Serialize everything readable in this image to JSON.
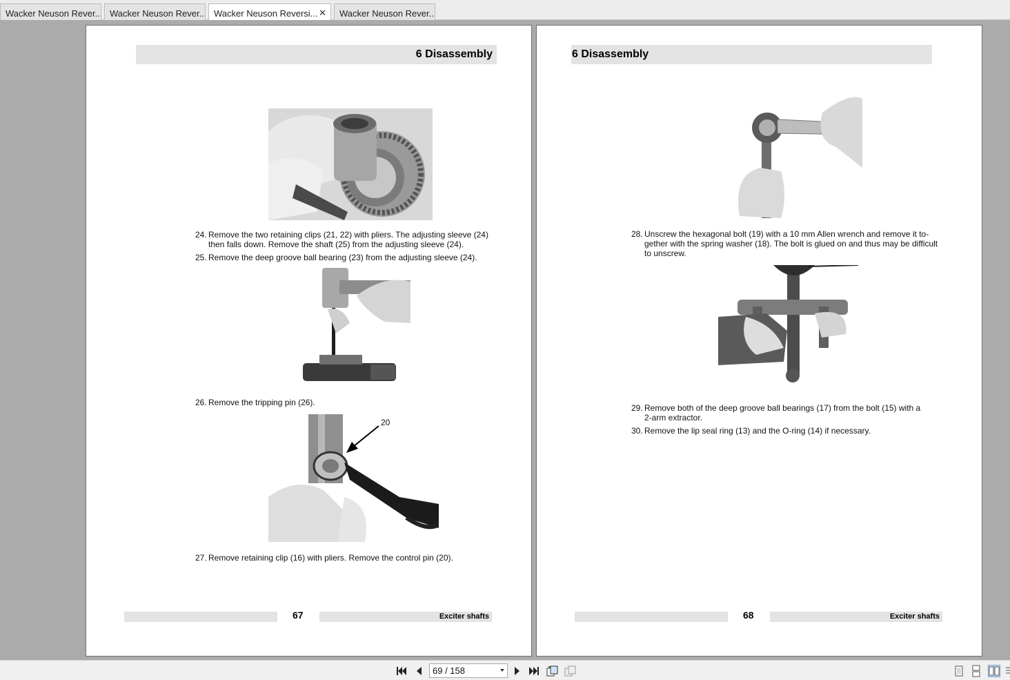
{
  "tabs": [
    {
      "label": "Wacker Neuson Rever..."
    },
    {
      "label": "Wacker Neuson Rever..."
    },
    {
      "label": "Wacker Neuson Reversi...",
      "active": true
    },
    {
      "label": "Wacker Neuson Rever..."
    }
  ],
  "left_page": {
    "chapter_num": "6",
    "chapter_title": "Disassembly",
    "steps": [
      {
        "num": "24.",
        "lines": [
          "Remove the two retaining clips (21, 22) with pliers. The adjusting sleeve (24)",
          "then falls down. Remove the shaft (25) from the adjusting sleeve (24)."
        ]
      },
      {
        "num": "25.",
        "lines": [
          "Remove the deep groove ball bearing (23) from the adjusting sleeve (24)."
        ]
      },
      {
        "num": "26.",
        "lines": [
          "Remove the tripping pin (26)."
        ]
      },
      {
        "num": "27.",
        "lines": [
          "Remove retaining clip (16) with pliers. Remove the control pin (20)."
        ]
      }
    ],
    "callout": "20",
    "page_number": "67",
    "section": "Exciter shafts"
  },
  "right_page": {
    "chapter_num": "6",
    "chapter_title": "Disassembly",
    "steps": [
      {
        "num": "28.",
        "lines": [
          "Unscrew the hexagonal bolt (19) with a 10 mm Allen wrench and remove it to-",
          "gether with the spring washer (18). The bolt is glued on and thus may be difficult",
          "to unscrew."
        ]
      },
      {
        "num": "29.",
        "lines": [
          "Remove both of the deep groove ball bearings (17) from the bolt (15) with a",
          "2-arm extractor."
        ]
      },
      {
        "num": "30.",
        "lines": [
          "Remove the lip seal ring (13) and the O-ring (14) if necessary."
        ]
      }
    ],
    "page_number": "68",
    "section": "Exciter shafts"
  },
  "toolbar": {
    "page_display": "69 / 158",
    "icons": [
      "first-page-icon",
      "prev-page-icon",
      "next-page-icon",
      "last-page-icon",
      "rotate-icon",
      "rotate-other-icon",
      "single-page-icon",
      "continuous-page-icon",
      "facing-pages-icon",
      "continuous-facing-icon"
    ]
  }
}
